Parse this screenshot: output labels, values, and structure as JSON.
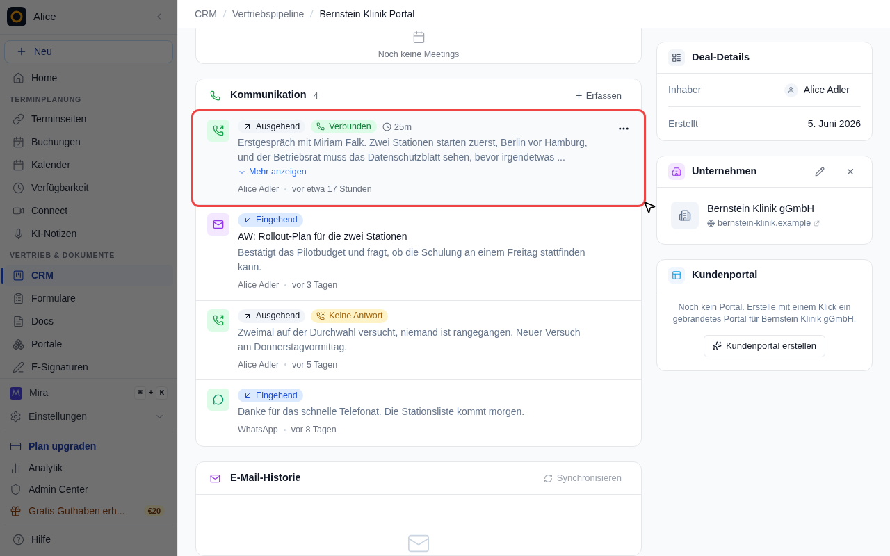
{
  "sidebar": {
    "dimmed": true,
    "workspace": "Alice",
    "new_button": "Neu",
    "top_items": [
      {
        "label": "Home",
        "selected": false
      }
    ],
    "sections": [
      {
        "heading": "TERMINPLANUNG",
        "items": [
          {
            "label": "Terminseiten",
            "selected": false
          },
          {
            "label": "Buchungen",
            "selected": false
          },
          {
            "label": "Kalender",
            "selected": false
          },
          {
            "label": "Verfügbarkeit",
            "selected": false
          },
          {
            "label": "Connect",
            "selected": false
          },
          {
            "label": "KI-Notizen",
            "selected": false
          }
        ]
      },
      {
        "heading": "VERTRIEB & DOKUMENTE",
        "items": [
          {
            "label": "CRM",
            "selected": true
          },
          {
            "label": "Formulare",
            "selected": false
          },
          {
            "label": "Docs",
            "selected": false
          },
          {
            "label": "Portale",
            "selected": false
          },
          {
            "label": "E-Signaturen",
            "selected": false
          }
        ]
      }
    ],
    "assistant": {
      "label": "Mira",
      "keys": [
        "⌘",
        "+",
        "K"
      ]
    },
    "settings": {
      "label": "Einstellungen",
      "expanded": false
    },
    "bottom_items": [
      {
        "label": "Plan upgraden",
        "kind": "upgrade"
      },
      {
        "label": "Analytik",
        "kind": "plain"
      },
      {
        "label": "Admin Center",
        "kind": "plain"
      },
      {
        "label": "Gratis Guthaben erh...",
        "kind": "promo",
        "badge": "€20"
      }
    ],
    "help": "Hilfe"
  },
  "breadcrumb": [
    "CRM",
    "Vertriebspipeline",
    "Bernstein Klinik Portal"
  ],
  "meetings": {
    "empty_text": "Noch keine Meetings"
  },
  "communication": {
    "title": "Kommunikation",
    "count": "4",
    "add_button": "Erfassen",
    "items": [
      {
        "kind": "call",
        "highlighted": true,
        "direction": {
          "label": "Ausgehend",
          "kind": "outgoing"
        },
        "status": {
          "label": "Verbunden",
          "kind": "connected"
        },
        "duration": "25m",
        "body": "Erstgespräch mit Miriam Falk. Zwei Stationen starten zuerst, Berlin vor Hamburg, und der Betriebsrat muss das Datenschutzblatt sehen, bevor irgendetwas ...",
        "more": "Mehr anzeigen",
        "author": "Alice Adler",
        "time": "vor etwa 17 Stunden"
      },
      {
        "kind": "email",
        "highlighted": false,
        "direction": {
          "label": "Eingehend",
          "kind": "incoming"
        },
        "subject": "AW: Rollout-Plan für die zwei Stationen",
        "body": "Bestätigt das Pilotbudget und fragt, ob die Schulung an einem Freitag stattfinden kann.",
        "author": "Alice Adler",
        "time": "vor 3 Tagen"
      },
      {
        "kind": "call",
        "highlighted": false,
        "direction": {
          "label": "Ausgehend",
          "kind": "outgoing"
        },
        "status": {
          "label": "Keine Antwort",
          "kind": "no_answer"
        },
        "body": "Zweimal auf der Durchwahl versucht, niemand ist rangegangen. Neuer Versuch am Donnerstagvormittag.",
        "author": "Alice Adler",
        "time": "vor 5 Tagen"
      },
      {
        "kind": "chat",
        "highlighted": false,
        "direction": {
          "label": "Eingehend",
          "kind": "incoming"
        },
        "body": "Danke für das schnelle Telefonat. Die Stationsliste kommt morgen.",
        "author": "WhatsApp",
        "time": "vor 8 Tagen"
      }
    ]
  },
  "email_history": {
    "title": "E-Mail-Historie",
    "sync_button": "Synchronisieren"
  },
  "deal_details": {
    "title": "Deal-Details",
    "rows": [
      {
        "label": "Inhaber",
        "value": "Alice Adler",
        "kind": "person"
      },
      {
        "label": "Erstellt",
        "value": "5. Juni 2026",
        "kind": "text"
      }
    ]
  },
  "company": {
    "title": "Unternehmen",
    "name": "Bernstein Klinik gGmbH",
    "website": "bernstein-klinik.example"
  },
  "customer_portal": {
    "title": "Kundenportal",
    "text": "Noch kein Portal. Erstelle mit einem Klick ein gebrandetes Portal für Bernstein Klinik gGmbH.",
    "button": "Kundenportal erstellen"
  }
}
